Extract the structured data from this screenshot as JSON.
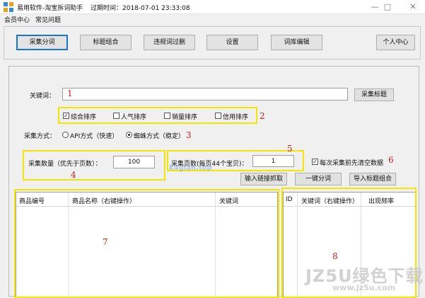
{
  "window": {
    "title": "易用软件-淘宝拆词助手",
    "expiry": "过期时间：2018-07-01 23:33:08",
    "minimize": "—",
    "maximize": "□",
    "close": "✕"
  },
  "menu": {
    "items": [
      "会员中心",
      "常见问题"
    ]
  },
  "toolbar": {
    "collect_words": "采集分词",
    "title_combine": "标题组合",
    "remove_banned": "违规词过删",
    "settings": "设置",
    "dict_edit": "词库编辑",
    "personal_center": "个人中心"
  },
  "keyword": {
    "label": "关键词：",
    "value": "",
    "button": "采集标题",
    "marker": "1"
  },
  "sort": {
    "options": [
      {
        "label": "综合排序",
        "checked": true
      },
      {
        "label": "人气排序",
        "checked": false
      },
      {
        "label": "销量排序",
        "checked": false
      },
      {
        "label": "信用排序",
        "checked": false
      }
    ],
    "marker": "2"
  },
  "method": {
    "label": "采集方式：",
    "api": "API方式（快速）",
    "spider": "蜘蛛方式（稳定）",
    "selected": "spider",
    "marker": "3"
  },
  "quantity": {
    "label": "采集数量（优先于页数）：",
    "value": "100",
    "marker": "4"
  },
  "pages": {
    "label": "采集页数(每页44个宝贝)：",
    "value": "1",
    "marker": "5"
  },
  "clear_before": {
    "label": "每次采集前先清空数据",
    "checked": true,
    "marker": "6"
  },
  "actions": {
    "link_capture": "输入链接抓取",
    "one_key": "一键分词",
    "import_combine": "导入标题组合"
  },
  "product_grid": {
    "headers": [
      "商品编号",
      "商品名称（右键操作）",
      "关键词"
    ],
    "marker": "7"
  },
  "keyword_grid": {
    "headers": [
      "ID",
      "关键词（右键操作）",
      "出现频率"
    ],
    "marker": "8"
  },
  "watermarks": {
    "site_small": "k4gian.top",
    "site_big": "JZ5U绿色下载",
    "site_url": "www.jz5u.com"
  },
  "colors": {
    "highlight_box": "#f2e600",
    "marker_red": "#c81e1e",
    "focus_blue": "#1a74d4"
  }
}
